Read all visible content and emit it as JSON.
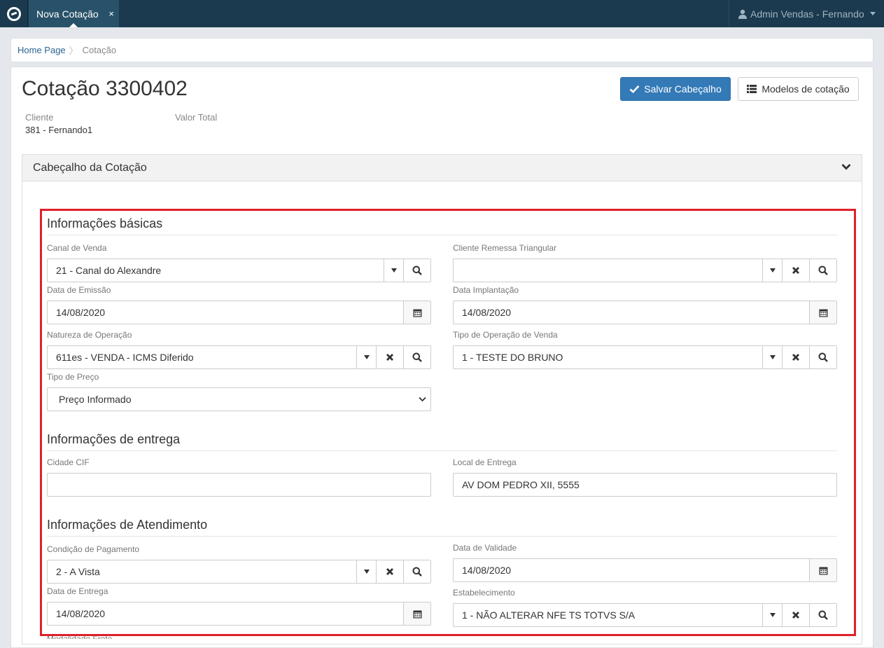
{
  "topbar": {
    "tab_label": "Nova Cotação",
    "tab_close": "×",
    "user_label": "Admin Vendas - Fernando"
  },
  "breadcrumb": {
    "home": "Home Page",
    "current": "Cotação"
  },
  "header": {
    "title": "Cotação 3300402",
    "save_button": "Salvar Cabeçalho",
    "models_button": "Modelos de cotação",
    "cliente_label": "Cliente",
    "cliente_value": "381 - Fernando1",
    "valor_total_label": "Valor Total"
  },
  "panel": {
    "title": "Cabeçalho da Cotação"
  },
  "basic": {
    "section_title": "Informações básicas",
    "canal_label": "Canal de Venda",
    "canal_value": "21 - Canal do Alexandre",
    "cliente_remessa_label": "Cliente Remessa Triangular",
    "cliente_remessa_value": "",
    "data_emissao_label": "Data de Emissão",
    "data_emissao_value": "14/08/2020",
    "data_implantacao_label": "Data Implantação",
    "data_implantacao_value": "14/08/2020",
    "natureza_label": "Natureza de Operação",
    "natureza_value": "611es - VENDA - ICMS Diferido",
    "tipo_operacao_label": "Tipo de Operação de Venda",
    "tipo_operacao_value": "1 - TESTE DO BRUNO",
    "tipo_preco_label": "Tipo de Preço",
    "tipo_preco_value": "Preço Informado"
  },
  "delivery": {
    "section_title": "Informações de entrega",
    "cidade_cif_label": "Cidade CIF",
    "cidade_cif_value": "",
    "local_entrega_label": "Local de Entrega",
    "local_entrega_value": "AV DOM PEDRO XII, 5555"
  },
  "service": {
    "section_title": "Informações de Atendimento",
    "condicao_label": "Condição de Pagamento",
    "condicao_value": "2 - A Vista",
    "data_validade_label": "Data de Validade",
    "data_validade_value": "14/08/2020",
    "data_entrega_label": "Data de Entrega",
    "data_entrega_value": "14/08/2020",
    "estabelecimento_label": "Estabelecimento",
    "estabelecimento_value": "1 - NÃO ALTERAR NFE TS TOTVS S/A",
    "next_label_cut": "Modalidade Frete"
  },
  "colors": {
    "topbar": "#1b3a4f",
    "active_tab": "#285269",
    "primary": "#337ab7",
    "highlight": "#e0202a"
  },
  "icons": [
    "logo-icon",
    "user-icon",
    "check-icon",
    "list-icon",
    "chevron-down-icon",
    "caret-down-icon",
    "search-icon",
    "clear-icon",
    "calendar-icon"
  ]
}
